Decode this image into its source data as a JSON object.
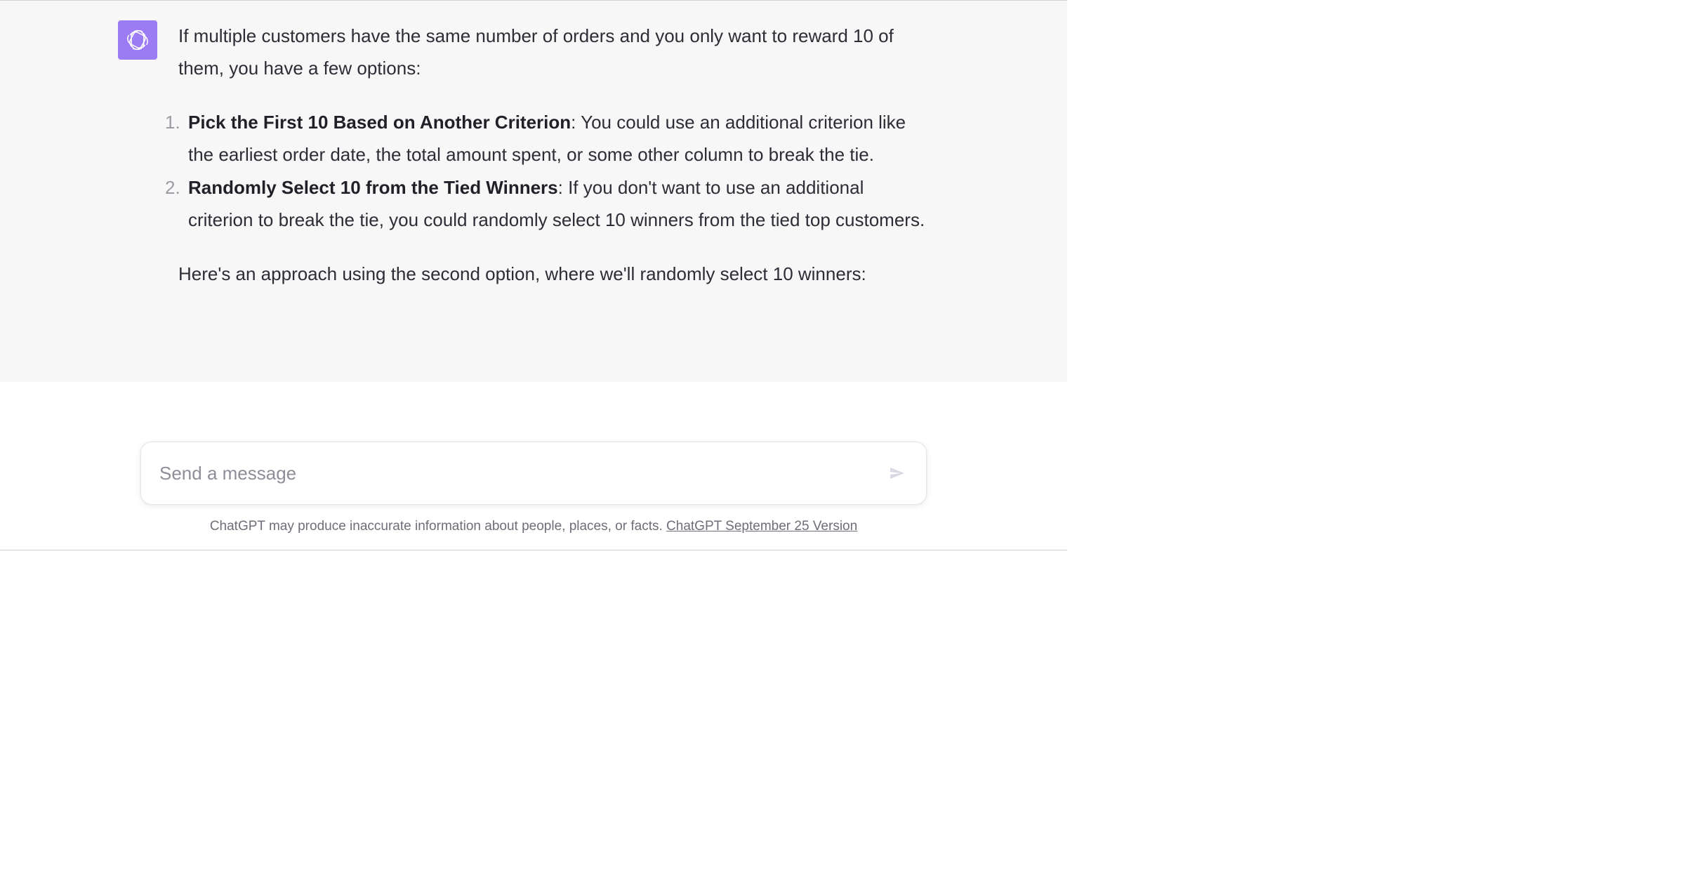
{
  "assistant": {
    "avatar_icon": "openai-logo",
    "intro": "If multiple customers have the same number of orders and you only want to reward 10 of them, you have a few options:",
    "list": [
      {
        "num": "1.",
        "bold": "Pick the First 10 Based on Another Criterion",
        "rest": ": You could use an additional criterion like the earliest order date, the total amount spent, or some other column to break the tie."
      },
      {
        "num": "2.",
        "bold": "Randomly Select 10 from the Tied Winners",
        "rest": ": If you don't want to use an additional criterion to break the tie, you could randomly select 10 winners from the tied top customers."
      }
    ],
    "outro": "Here's an approach using the second option, where we'll randomly select 10 winners:"
  },
  "composer": {
    "placeholder": "Send a message"
  },
  "footer": {
    "disclaimer": "ChatGPT may produce inaccurate information about people, places, or facts. ",
    "version": "ChatGPT September 25 Version"
  }
}
